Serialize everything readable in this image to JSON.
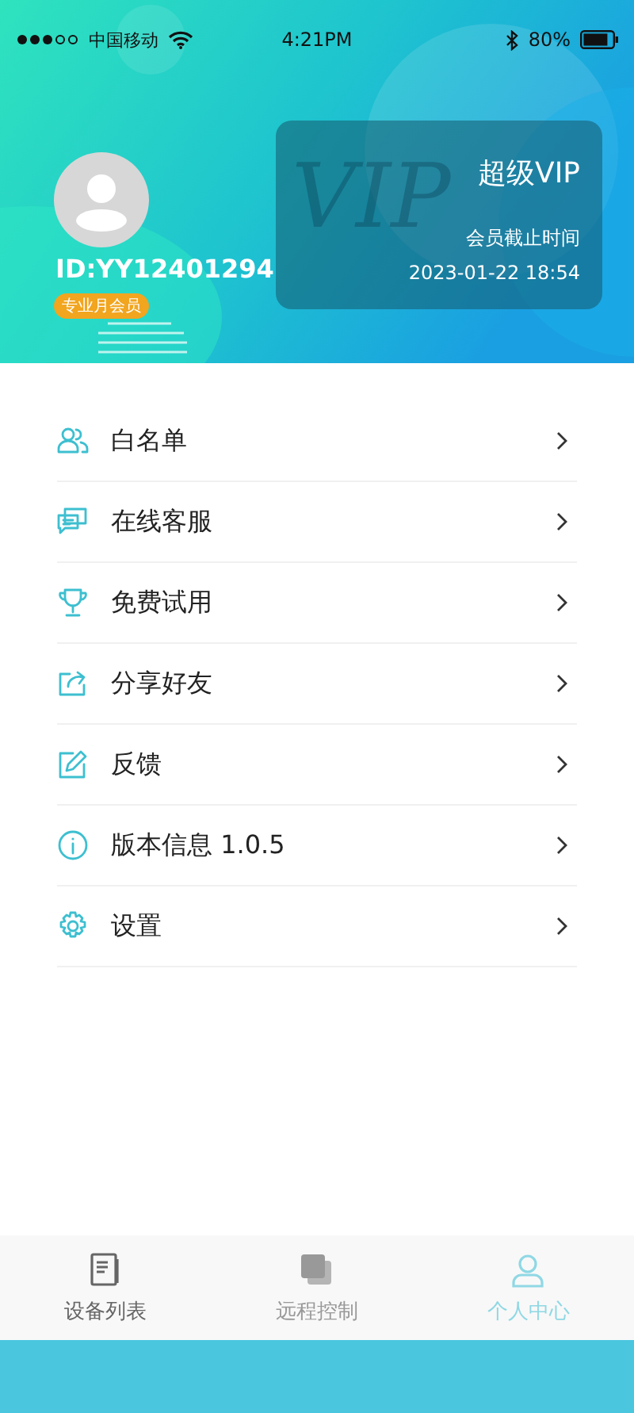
{
  "status_bar": {
    "carrier": "中国移动",
    "time": "4:21PM",
    "battery": "80%"
  },
  "profile": {
    "user_id": "ID:YY12401294",
    "badge": "专业月会员"
  },
  "vip_card": {
    "emblem": "VIP",
    "title": "超级VIP",
    "expiry_label": "会员截止时间",
    "expiry": "2023-01-22 18:54"
  },
  "menu": [
    {
      "label": "白名单"
    },
    {
      "label": "在线客服"
    },
    {
      "label": "免费试用"
    },
    {
      "label": "分享好友"
    },
    {
      "label": "反馈"
    },
    {
      "label": "版本信息 1.0.5"
    },
    {
      "label": "设置"
    }
  ],
  "tabs": [
    {
      "label": "设备列表",
      "selected": false
    },
    {
      "label": "远程控制",
      "selected": false
    },
    {
      "label": "个人中心",
      "selected": true
    }
  ]
}
